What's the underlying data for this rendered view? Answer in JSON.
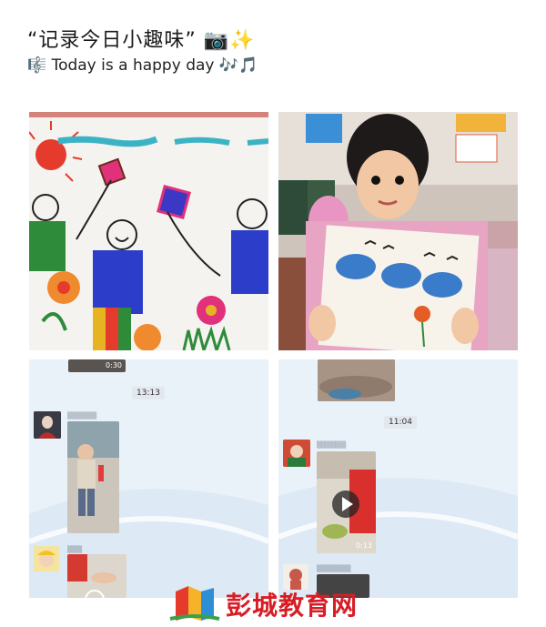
{
  "post": {
    "title": "“记录今日小趣味”",
    "title_emojis": "📷✨",
    "subtitle_icon": "🎼",
    "subtitle": "Today is a happy day",
    "subtitle_emojis": "🎶🎵"
  },
  "chat_left": {
    "top_video_duration": "0:30",
    "timestamp": "13:13"
  },
  "chat_right": {
    "timestamp": "11:04",
    "video_duration": "0:13"
  },
  "watermark": {
    "text": "彭城教育网"
  },
  "colors": {
    "brand_red": "#d71d25",
    "chat_bg": "#e9f1f8"
  }
}
